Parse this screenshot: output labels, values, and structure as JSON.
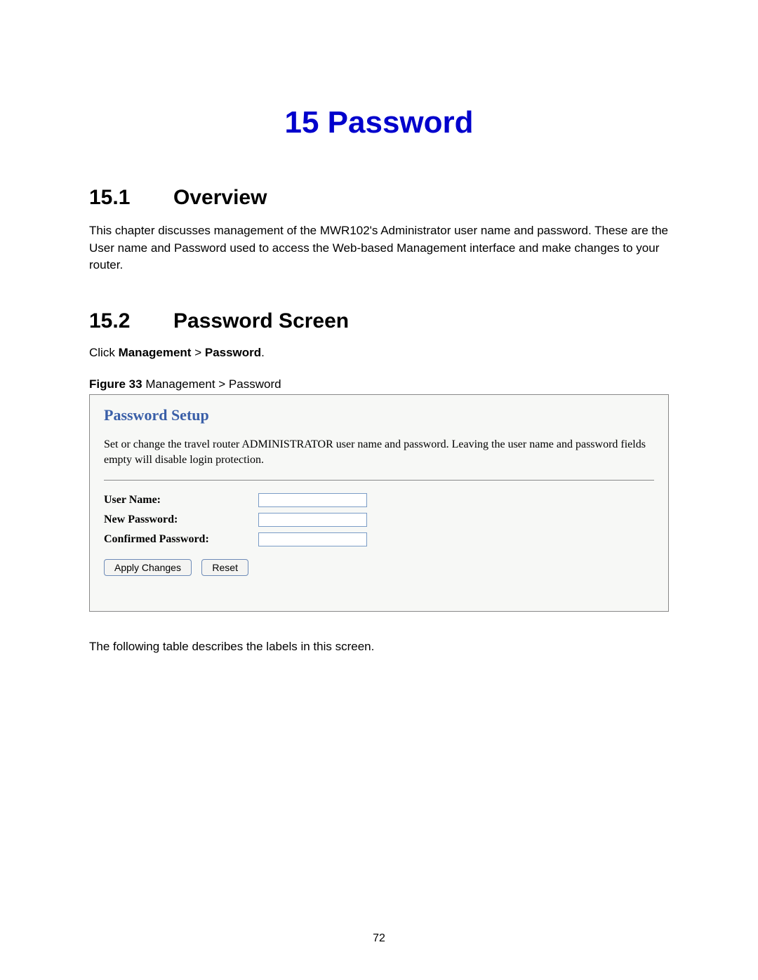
{
  "chapter": {
    "number": "15",
    "title": "Password"
  },
  "section1": {
    "number": "15.1",
    "title": "Overview",
    "body": "This chapter discusses management of the MWR102's Administrator user name and password. These are the User name and Password used to access the Web-based Management interface and make changes to your router."
  },
  "section2": {
    "number": "15.2",
    "title": "Password Screen",
    "instruction_prefix": "Click ",
    "instruction_bold1": "Management",
    "instruction_sep": " > ",
    "instruction_bold2": "Password",
    "instruction_suffix": ".",
    "figure_label": "Figure 33",
    "figure_title": "  Management > Password"
  },
  "figure": {
    "setup_title": "Password Setup",
    "setup_desc": "Set or change the travel router ADMINISTRATOR user name and password. Leaving the user name and password fields empty will disable login protection.",
    "labels": {
      "username": "User Name:",
      "new_password": "New Password:",
      "confirmed_password": "Confirmed Password:"
    },
    "buttons": {
      "apply": "Apply Changes",
      "reset": "Reset"
    }
  },
  "footer_text": "The following table describes the labels in this screen.",
  "page_number": "72"
}
